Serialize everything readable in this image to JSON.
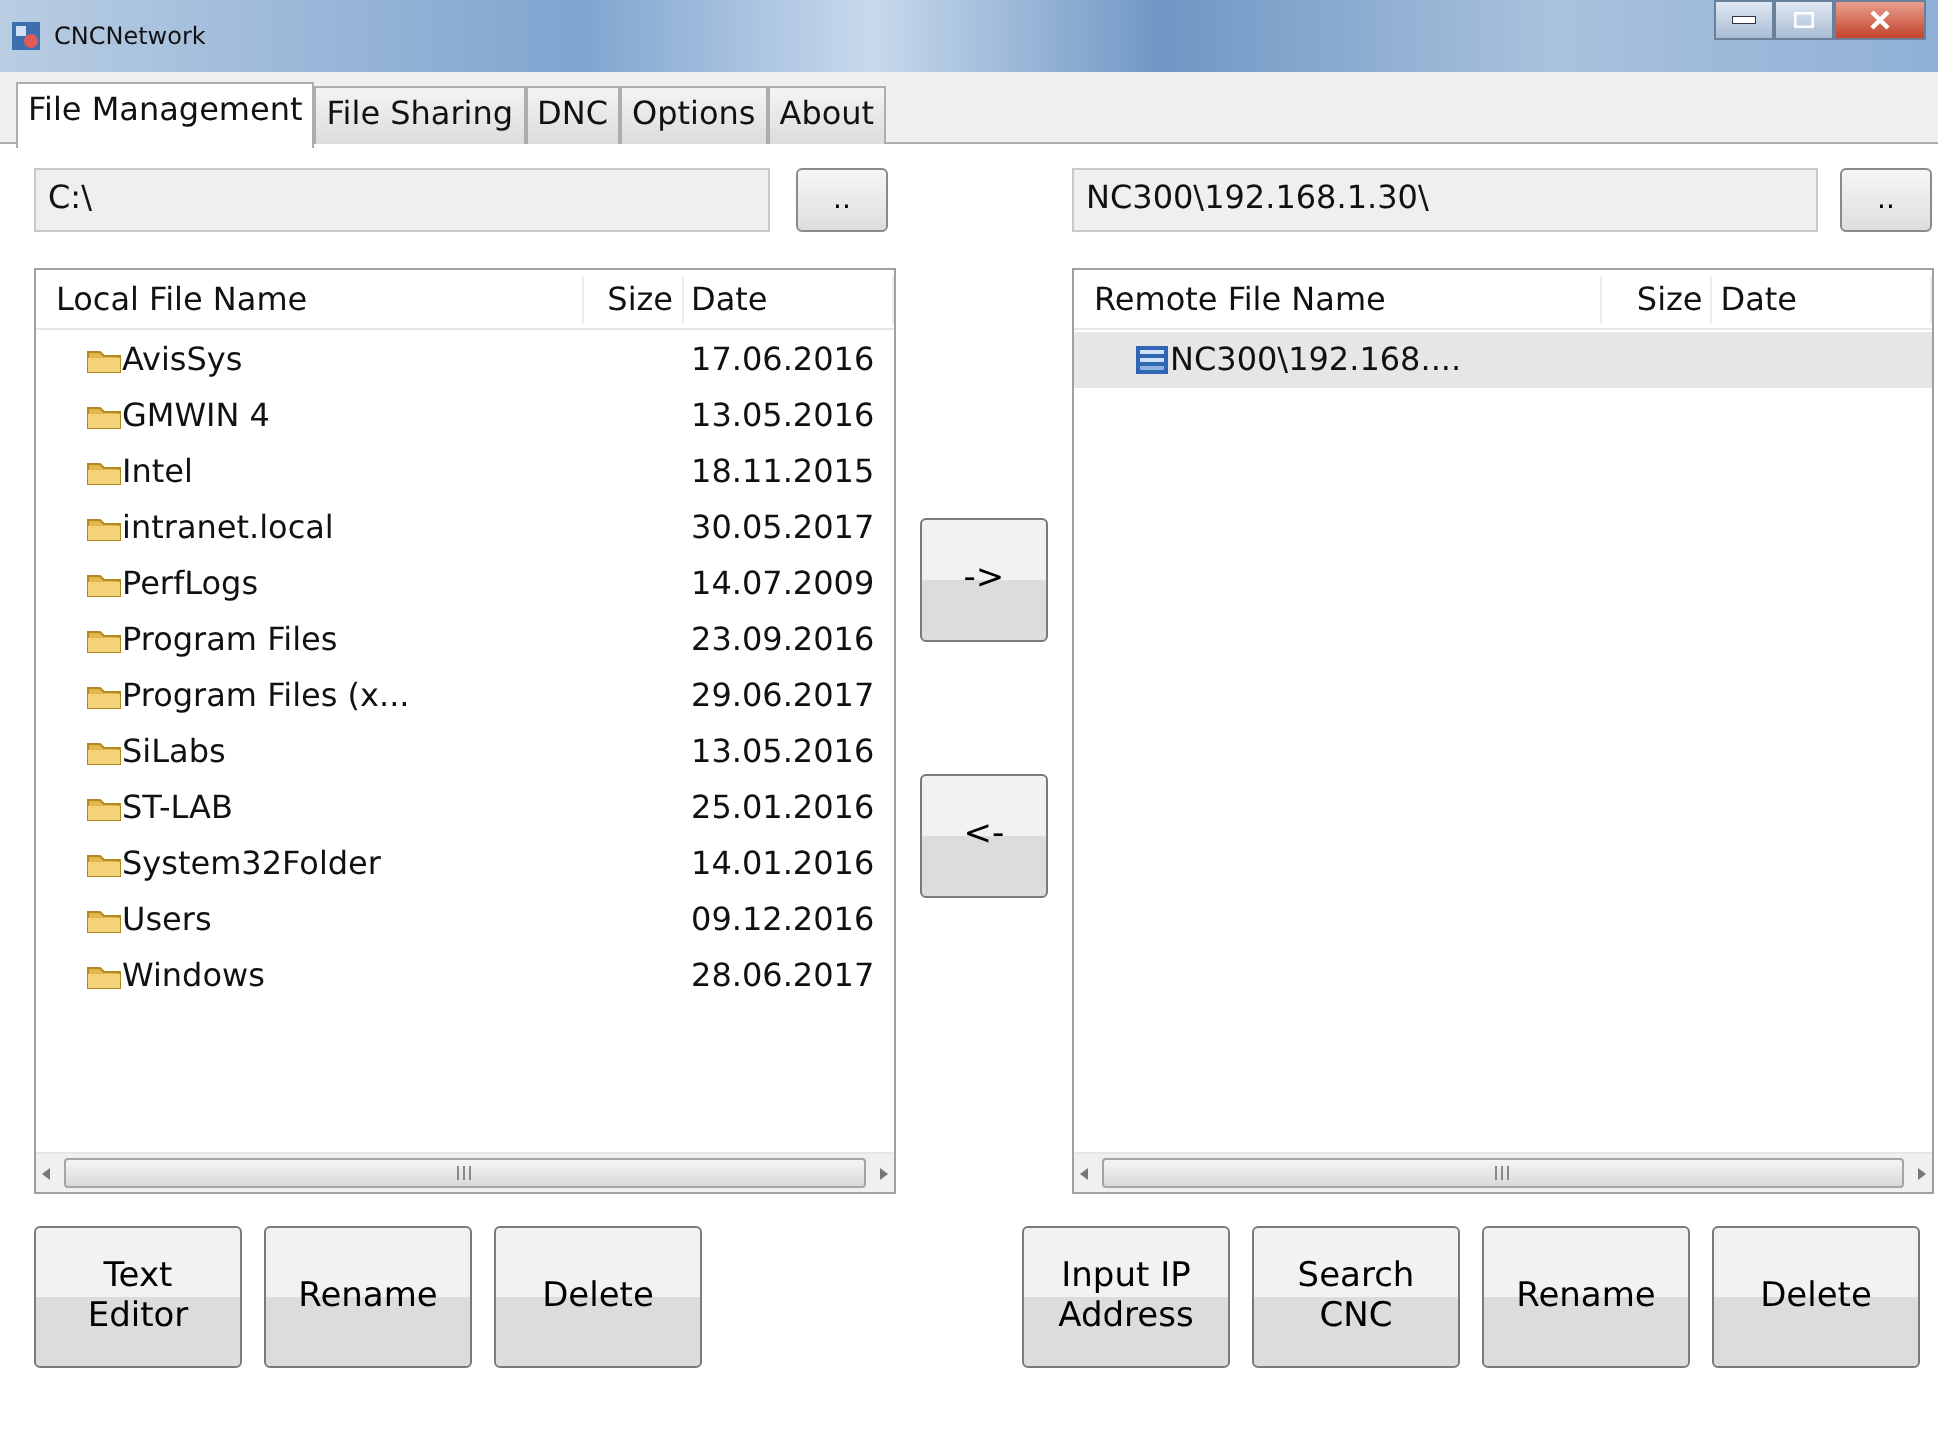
{
  "window": {
    "title": "CNCNetwork"
  },
  "tabs": [
    {
      "label": "File Management",
      "selected": true
    },
    {
      "label": "File Sharing",
      "selected": false
    },
    {
      "label": "DNC",
      "selected": false
    },
    {
      "label": "Options",
      "selected": false
    },
    {
      "label": "About",
      "selected": false
    }
  ],
  "local": {
    "path": "C:\\",
    "browse_button": "..",
    "columns": [
      "Local File Name",
      "Size",
      "Date"
    ],
    "rows": [
      {
        "name": "AvisSys",
        "size": "",
        "date": "17.06.2016",
        "selected": false
      },
      {
        "name": "GMWIN 4",
        "size": "",
        "date": "13.05.2016",
        "selected": false
      },
      {
        "name": "Intel",
        "size": "",
        "date": "18.11.2015",
        "selected": false
      },
      {
        "name": "intranet.local",
        "size": "",
        "date": "30.05.2017",
        "selected": false
      },
      {
        "name": "PerfLogs",
        "size": "",
        "date": "14.07.2009",
        "selected": false
      },
      {
        "name": "Program Files",
        "size": "",
        "date": "23.09.2016",
        "selected": false
      },
      {
        "name": "Program Files (x...",
        "size": "",
        "date": "29.06.2017",
        "selected": false
      },
      {
        "name": "SiLabs",
        "size": "",
        "date": "13.05.2016",
        "selected": false
      },
      {
        "name": "ST-LAB",
        "size": "",
        "date": "25.01.2016",
        "selected": false
      },
      {
        "name": "System32Folder",
        "size": "",
        "date": "14.01.2016",
        "selected": false
      },
      {
        "name": "Users",
        "size": "",
        "date": "09.12.2016",
        "selected": false
      },
      {
        "name": "Windows",
        "size": "",
        "date": "28.06.2017",
        "selected": false
      }
    ],
    "buttons": [
      "Text\nEditor",
      "Rename",
      "Delete"
    ]
  },
  "transfer_buttons": [
    "->",
    "<-"
  ],
  "remote": {
    "path": "NC300\\192.168.1.30\\",
    "browse_button": "..",
    "columns": [
      "Remote File Name",
      "Size",
      "Date"
    ],
    "rows": [
      {
        "name": "NC300\\192.168....",
        "size": "",
        "date": "",
        "selected": true
      }
    ],
    "buttons": [
      "Input IP\nAddress",
      "Search\nCNC",
      "Rename",
      "Delete"
    ]
  }
}
